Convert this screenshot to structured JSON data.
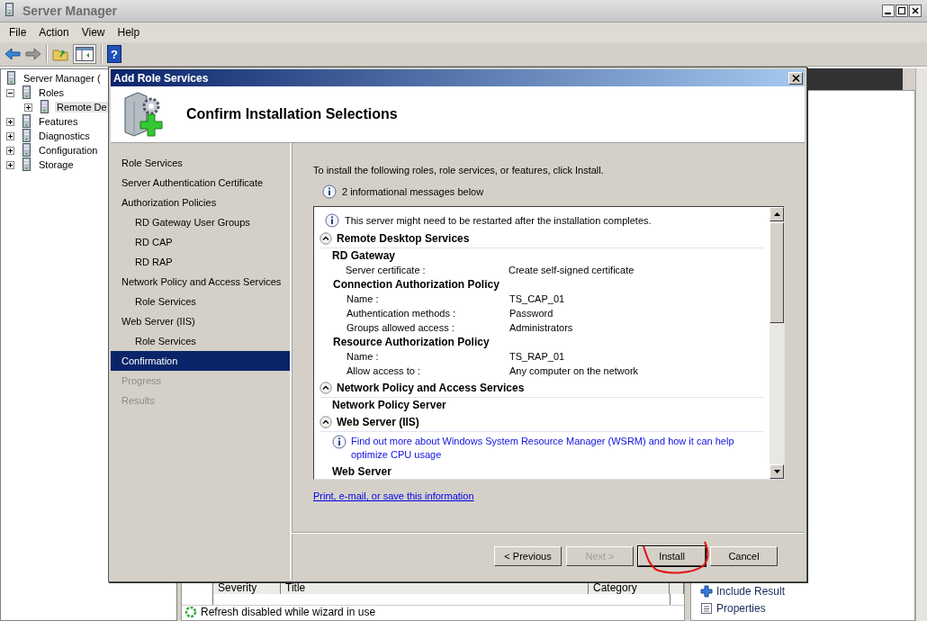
{
  "window": {
    "title": "Server Manager"
  },
  "menu": [
    "File",
    "Action",
    "View",
    "Help"
  ],
  "toolbar": {
    "help": "?"
  },
  "tree": {
    "label": "Server Manager (",
    "selected": false,
    "children": [
      {
        "label": "Roles",
        "expanded": true,
        "selected": false,
        "children": [
          {
            "label": "Remote De",
            "expanded": false,
            "selected": true
          }
        ]
      },
      {
        "label": "Features",
        "expanded": false,
        "selected": false
      },
      {
        "label": "Diagnostics",
        "expanded": false,
        "selected": false
      },
      {
        "label": "Configuration",
        "expanded": false,
        "selected": false
      },
      {
        "label": "Storage",
        "expanded": false,
        "selected": false
      }
    ]
  },
  "results_table": {
    "columns": [
      "Severity",
      "Title",
      "Category"
    ]
  },
  "actions": [
    "Include Result",
    "Properties"
  ],
  "status_bar": "Refresh disabled while wizard in use",
  "dialog": {
    "title": "Add Role Services",
    "heading": "Confirm Installation Selections",
    "steps": [
      {
        "label": "Role Services",
        "selected": false,
        "disabled": false
      },
      {
        "label": "Server Authentication Certificate",
        "selected": false,
        "disabled": false
      },
      {
        "label": "Authorization Policies",
        "selected": false,
        "disabled": false,
        "children": [
          {
            "label": "RD Gateway User Groups",
            "selected": false,
            "disabled": false
          },
          {
            "label": "RD CAP",
            "selected": false,
            "disabled": false
          },
          {
            "label": "RD RAP",
            "selected": false,
            "disabled": false
          }
        ]
      },
      {
        "label": "Network Policy and Access Services",
        "selected": false,
        "disabled": false,
        "children": [
          {
            "label": "Role Services",
            "selected": false,
            "disabled": false
          }
        ]
      },
      {
        "label": "Web Server (IIS)",
        "selected": false,
        "disabled": false,
        "children": [
          {
            "label": "Role Services",
            "selected": false,
            "disabled": false
          }
        ]
      },
      {
        "label": "Confirmation",
        "selected": true,
        "disabled": false
      },
      {
        "label": "Progress",
        "selected": false,
        "disabled": true
      },
      {
        "label": "Results",
        "selected": false,
        "disabled": true
      }
    ],
    "intro": "To install the following roles, role services, or features, click Install.",
    "message_count": "2 informational messages below",
    "details": [
      {
        "kind": "info",
        "text": "This server might need to be restarted after the installation completes."
      },
      {
        "kind": "section",
        "title": "Remote Desktop Services",
        "expanded": true,
        "children": [
          {
            "kind": "group",
            "title": "RD Gateway",
            "children": [
              {
                "kind": "property",
                "label": "Server certificate :",
                "value": "Create self-signed certificate"
              },
              {
                "kind": "group",
                "title": "Connection Authorization Policy",
                "children": [
                  {
                    "kind": "property",
                    "label": "Name :",
                    "value": "TS_CAP_01"
                  },
                  {
                    "kind": "property",
                    "label": "Authentication methods :",
                    "value": "Password"
                  },
                  {
                    "kind": "property",
                    "label": "Groups allowed access :",
                    "value": "Administrators"
                  }
                ]
              },
              {
                "kind": "group",
                "title": "Resource Authorization Policy",
                "children": [
                  {
                    "kind": "property",
                    "label": "Name :",
                    "value": "TS_RAP_01"
                  },
                  {
                    "kind": "property",
                    "label": "Allow access to :",
                    "value": "Any computer on the network"
                  }
                ]
              }
            ]
          }
        ]
      },
      {
        "kind": "section",
        "title": "Network Policy and Access Services",
        "expanded": true,
        "children": [
          {
            "kind": "group",
            "title": "Network Policy Server"
          }
        ]
      },
      {
        "kind": "section",
        "title": "Web Server (IIS)",
        "expanded": true,
        "children": [
          {
            "kind": "link",
            "text": "Find out more about Windows System Resource Manager (WSRM) and how it can help optimize CPU usage"
          },
          {
            "kind": "group",
            "title": "Web Server"
          }
        ]
      }
    ],
    "link": "Print, e-mail, or save this information",
    "buttons": [
      {
        "label": "< Previous",
        "disabled": false,
        "default": false
      },
      {
        "label": "Next >",
        "disabled": true,
        "default": false
      },
      {
        "label": "Install",
        "disabled": false,
        "default": true
      },
      {
        "label": "Cancel",
        "disabled": false,
        "default": false
      }
    ]
  }
}
